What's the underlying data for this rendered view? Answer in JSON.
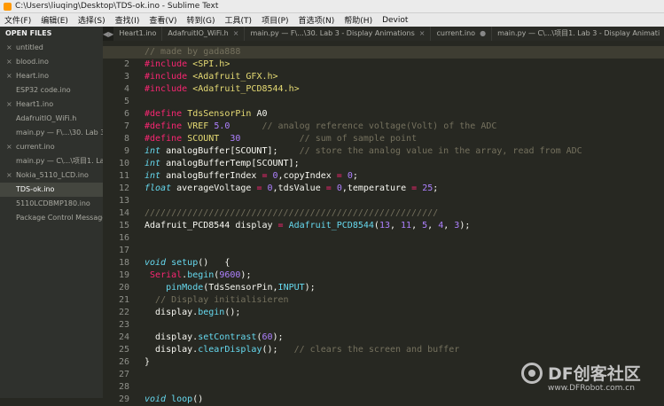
{
  "window": {
    "title": "C:\\Users\\liuqing\\Desktop\\TDS-ok.ino - Sublime Text"
  },
  "menu": [
    "文件(F)",
    "编辑(E)",
    "选择(S)",
    "查找(I)",
    "查看(V)",
    "转到(G)",
    "工具(T)",
    "项目(P)",
    "首选项(N)",
    "帮助(H)",
    "Deviot"
  ],
  "sidebar": {
    "header": "OPEN FILES",
    "items": [
      {
        "label": "untitled",
        "close": "×",
        "active": false
      },
      {
        "label": "blood.ino",
        "close": "×",
        "active": false
      },
      {
        "label": "Heart.ino",
        "close": "×",
        "active": false
      },
      {
        "label": "ESP32 code.ino",
        "close": "",
        "active": false
      },
      {
        "label": "Heart1.ino",
        "close": "×",
        "active": false
      },
      {
        "label": "AdafruitIO_WiFi.h",
        "close": "",
        "active": false
      },
      {
        "label": "main.py — F\\...\\30. Lab 3 - Dis",
        "close": "",
        "active": false
      },
      {
        "label": "current.ino",
        "close": "×",
        "active": false
      },
      {
        "label": "main.py — C\\...\\项目1. Lab",
        "close": "",
        "active": false
      },
      {
        "label": "Nokia_5110_LCD.ino",
        "close": "×",
        "active": false
      },
      {
        "label": "TDS-ok.ino",
        "close": "",
        "active": true
      },
      {
        "label": "5110LCDBMP180.ino",
        "close": "",
        "active": false
      },
      {
        "label": "Package Control Messages",
        "close": "",
        "active": false
      }
    ]
  },
  "tabs": {
    "nav_left": "◀",
    "nav_right": "▶",
    "items": [
      {
        "label": "Heart1.ino",
        "close": ""
      },
      {
        "label": "AdafruitIO_WiFi.h",
        "close": "×"
      },
      {
        "label": "main.py — F\\...\\30. Lab 3 - Display Animations",
        "close": "×"
      },
      {
        "label": "current.ino",
        "close": "●"
      },
      {
        "label": "main.py — C\\...\\项目1. Lab 3 - Display Animati",
        "close": ""
      }
    ]
  },
  "editor": {
    "current_line": 1,
    "line_numbers": [
      "1",
      "2",
      "3",
      "4",
      "5",
      "6",
      "7",
      "8",
      "9",
      "10",
      "11",
      "12",
      "13",
      "14",
      "15",
      "16",
      "17",
      "18",
      "19",
      "20",
      "21",
      "22",
      "23",
      "24",
      "25",
      "26",
      "27",
      "28",
      "29"
    ],
    "lines": [
      [
        [
          "cm",
          "// made by gada888"
        ]
      ],
      [
        [
          "kw",
          "#include"
        ],
        [
          "id",
          " "
        ],
        [
          "str",
          "<SPI.h>"
        ]
      ],
      [
        [
          "kw",
          "#include"
        ],
        [
          "id",
          " "
        ],
        [
          "str",
          "<Adafruit_GFX.h>"
        ]
      ],
      [
        [
          "kw",
          "#include"
        ],
        [
          "id",
          " "
        ],
        [
          "str",
          "<Adafruit_PCD8544.h>"
        ]
      ],
      [],
      [
        [
          "kw",
          "#define"
        ],
        [
          "id",
          " "
        ],
        [
          "str",
          "TdsSensorPin"
        ],
        [
          "id",
          " A0"
        ]
      ],
      [
        [
          "kw",
          "#define"
        ],
        [
          "id",
          " "
        ],
        [
          "str",
          "VREF"
        ],
        [
          "id",
          " "
        ],
        [
          "num",
          "5.0"
        ],
        [
          "id",
          "      "
        ],
        [
          "cm",
          "// analog reference voltage(Volt) of the ADC"
        ]
      ],
      [
        [
          "kw",
          "#define"
        ],
        [
          "id",
          " "
        ],
        [
          "str",
          "SCOUNT"
        ],
        [
          "id",
          "  "
        ],
        [
          "num",
          "30"
        ],
        [
          "id",
          "           "
        ],
        [
          "cm",
          "// sum of sample point"
        ]
      ],
      [
        [
          "ty",
          "int"
        ],
        [
          "id",
          " analogBuffer[SCOUNT];    "
        ],
        [
          "cm",
          "// store the analog value in the array, read from ADC"
        ]
      ],
      [
        [
          "ty",
          "int"
        ],
        [
          "id",
          " analogBufferTemp[SCOUNT];"
        ]
      ],
      [
        [
          "ty",
          "int"
        ],
        [
          "id",
          " analogBufferIndex "
        ],
        [
          "op",
          "="
        ],
        [
          "id",
          " "
        ],
        [
          "num",
          "0"
        ],
        [
          "id",
          ",copyIndex "
        ],
        [
          "op",
          "="
        ],
        [
          "id",
          " "
        ],
        [
          "num",
          "0"
        ],
        [
          "id",
          ";"
        ]
      ],
      [
        [
          "ty",
          "float"
        ],
        [
          "id",
          " averageVoltage "
        ],
        [
          "op",
          "="
        ],
        [
          "id",
          " "
        ],
        [
          "num",
          "0"
        ],
        [
          "id",
          ",tdsValue "
        ],
        [
          "op",
          "="
        ],
        [
          "id",
          " "
        ],
        [
          "num",
          "0"
        ],
        [
          "id",
          ",temperature "
        ],
        [
          "op",
          "="
        ],
        [
          "id",
          " "
        ],
        [
          "num",
          "25"
        ],
        [
          "id",
          ";"
        ]
      ],
      [],
      [
        [
          "cm",
          "///////////////////////////////////////////////////////"
        ]
      ],
      [
        [
          "id",
          "Adafruit_PCD8544 display "
        ],
        [
          "op",
          "="
        ],
        [
          "id",
          " "
        ],
        [
          "fn",
          "Adafruit_PCD8544"
        ],
        [
          "id",
          "("
        ],
        [
          "num",
          "13"
        ],
        [
          "id",
          ", "
        ],
        [
          "num",
          "11"
        ],
        [
          "id",
          ", "
        ],
        [
          "num",
          "5"
        ],
        [
          "id",
          ", "
        ],
        [
          "num",
          "4"
        ],
        [
          "id",
          ", "
        ],
        [
          "num",
          "3"
        ],
        [
          "id",
          ");"
        ]
      ],
      [],
      [],
      [
        [
          "ty",
          "void"
        ],
        [
          "id",
          " "
        ],
        [
          "fn",
          "setup"
        ],
        [
          "id",
          "()   {"
        ]
      ],
      [
        [
          "id",
          " "
        ],
        [
          "kw",
          "Serial"
        ],
        [
          "id",
          "."
        ],
        [
          "fn",
          "begin"
        ],
        [
          "id",
          "("
        ],
        [
          "num",
          "9600"
        ],
        [
          "id",
          ");"
        ]
      ],
      [
        [
          "id",
          "    "
        ],
        [
          "fn",
          "pinMode"
        ],
        [
          "id",
          "(TdsSensorPin,"
        ],
        [
          "fn",
          "INPUT"
        ],
        [
          "id",
          ");"
        ]
      ],
      [
        [
          "id",
          "  "
        ],
        [
          "cm",
          "// Display initialisieren"
        ]
      ],
      [
        [
          "id",
          "  display."
        ],
        [
          "fn",
          "begin"
        ],
        [
          "id",
          "();"
        ]
      ],
      [],
      [
        [
          "id",
          "  display."
        ],
        [
          "fn",
          "setContrast"
        ],
        [
          "id",
          "("
        ],
        [
          "num",
          "60"
        ],
        [
          "id",
          ");"
        ]
      ],
      [
        [
          "id",
          "  display."
        ],
        [
          "fn",
          "clearDisplay"
        ],
        [
          "id",
          "();   "
        ],
        [
          "cm",
          "// clears the screen and buffer"
        ]
      ],
      [
        [
          "id",
          "}"
        ]
      ],
      [],
      [],
      [
        [
          "ty",
          "void"
        ],
        [
          "id",
          " "
        ],
        [
          "fn",
          "loop"
        ],
        [
          "id",
          "()"
        ]
      ]
    ]
  },
  "watermark": {
    "name": "DF创客社区",
    "url": "www.DFRobot.com.cn"
  }
}
